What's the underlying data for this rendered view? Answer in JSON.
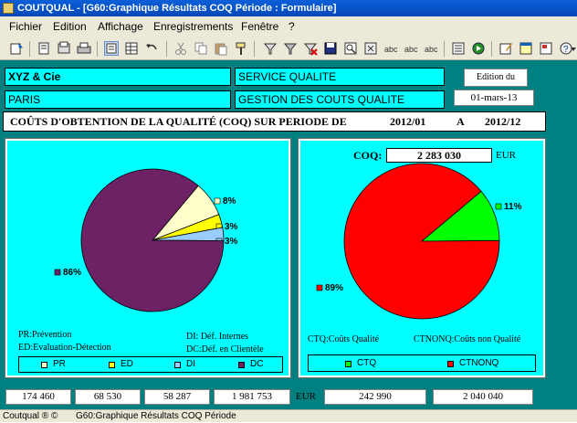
{
  "window": {
    "title": "COUTQUAL - [G60:Graphique Résultats COQ Période : Formulaire]"
  },
  "menu": [
    "Fichier",
    "Edition",
    "Affichage",
    "Enregistrements",
    "Fenêtre",
    "?"
  ],
  "header": {
    "company": "XYZ & Cie",
    "city": "PARIS",
    "service": "SERVICE QUALITE",
    "department": "GESTION DES COUTS QUALITE",
    "edition_label": "Edition du",
    "edition_date": "01-mars-13"
  },
  "period": {
    "label": "COÛTS D'OBTENTION DE LA QUALITÉ (COQ) SUR PERIODE DE",
    "start": "2012/01",
    "sep": "A",
    "end": "2012/12"
  },
  "colors": {
    "pr": "#ffffcc",
    "ed": "#ffff00",
    "di": "#99ccff",
    "dc": "#6d2266",
    "ctq": "#00ff00",
    "ctnonq": "#ff0000"
  },
  "left_notes": {
    "pr": "PR:Prévention",
    "ed": "ED:Evaluation-Détection",
    "di": "DI: Déf. Internes",
    "dc": "DC:Déf. en Clientèle"
  },
  "right_notes": {
    "ctq": "CTQ:Coûts Qualité",
    "ctnonq": "CTNONQ:Coûts non Qualité"
  },
  "coq": {
    "label": "COQ:",
    "value": "2 283 030",
    "unit": "EUR"
  },
  "chart_data": [
    {
      "type": "pie",
      "categories": [
        "PR",
        "ED",
        "DI",
        "DC"
      ],
      "values": [
        8,
        3,
        3,
        86
      ],
      "labels": [
        "8%",
        "3%",
        "3%",
        "86%"
      ],
      "colors": [
        "#ffffcc",
        "#ffff00",
        "#99ccff",
        "#6d2266"
      ],
      "legend": "bottom"
    },
    {
      "type": "pie",
      "categories": [
        "CTQ",
        "CTNONQ"
      ],
      "values": [
        11,
        89
      ],
      "labels": [
        "11%",
        "89%"
      ],
      "colors": [
        "#00ff00",
        "#ff0000"
      ],
      "legend": "bottom"
    }
  ],
  "totals": {
    "pr": "174 460",
    "ed": "68 530",
    "di": "58 287",
    "dc": "1 981 753",
    "unit": "EUR",
    "ctq": "242 990",
    "ctnonq": "2 040 040"
  },
  "status": {
    "app": "Coutqual ® ©",
    "text": "G60:Graphique Résultats COQ Période"
  }
}
